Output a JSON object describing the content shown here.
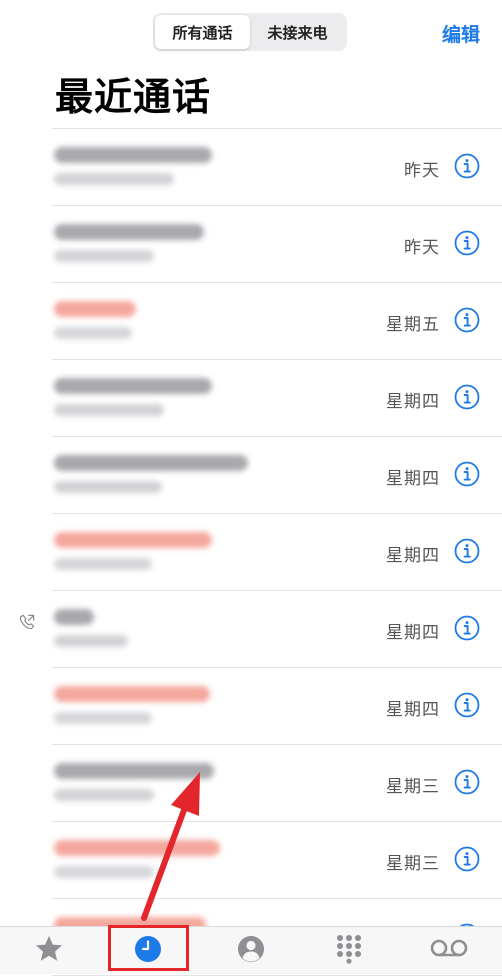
{
  "header": {
    "segments": [
      {
        "label": "所有通话",
        "active": true
      },
      {
        "label": "未接来电",
        "active": false
      }
    ],
    "edit_label": "编辑",
    "title": "最近通话"
  },
  "calls": [
    {
      "type": "normal",
      "date": "昨天"
    },
    {
      "type": "normal",
      "date": "昨天"
    },
    {
      "type": "missed",
      "date": "星期五"
    },
    {
      "type": "normal",
      "date": "星期四"
    },
    {
      "type": "normal",
      "date": "星期四"
    },
    {
      "type": "missed",
      "date": "星期四"
    },
    {
      "type": "outgoing",
      "date": "星期四"
    },
    {
      "type": "missed",
      "date": "星期四"
    },
    {
      "type": "normal",
      "date": "星期三"
    },
    {
      "type": "missed",
      "date": "星期三"
    },
    {
      "type": "missed"
    }
  ],
  "tabbar": {
    "tabs": [
      {
        "icon": "star-icon",
        "name": "favorites"
      },
      {
        "icon": "clock-icon",
        "name": "recents",
        "active": true
      },
      {
        "icon": "person-icon",
        "name": "contacts"
      },
      {
        "icon": "keypad-icon",
        "name": "keypad"
      },
      {
        "icon": "voicemail-icon",
        "name": "voicemail"
      }
    ]
  },
  "colors": {
    "accent": "#1e7ae6",
    "missed": "#f4a79c",
    "annotation": "#e2262c"
  }
}
